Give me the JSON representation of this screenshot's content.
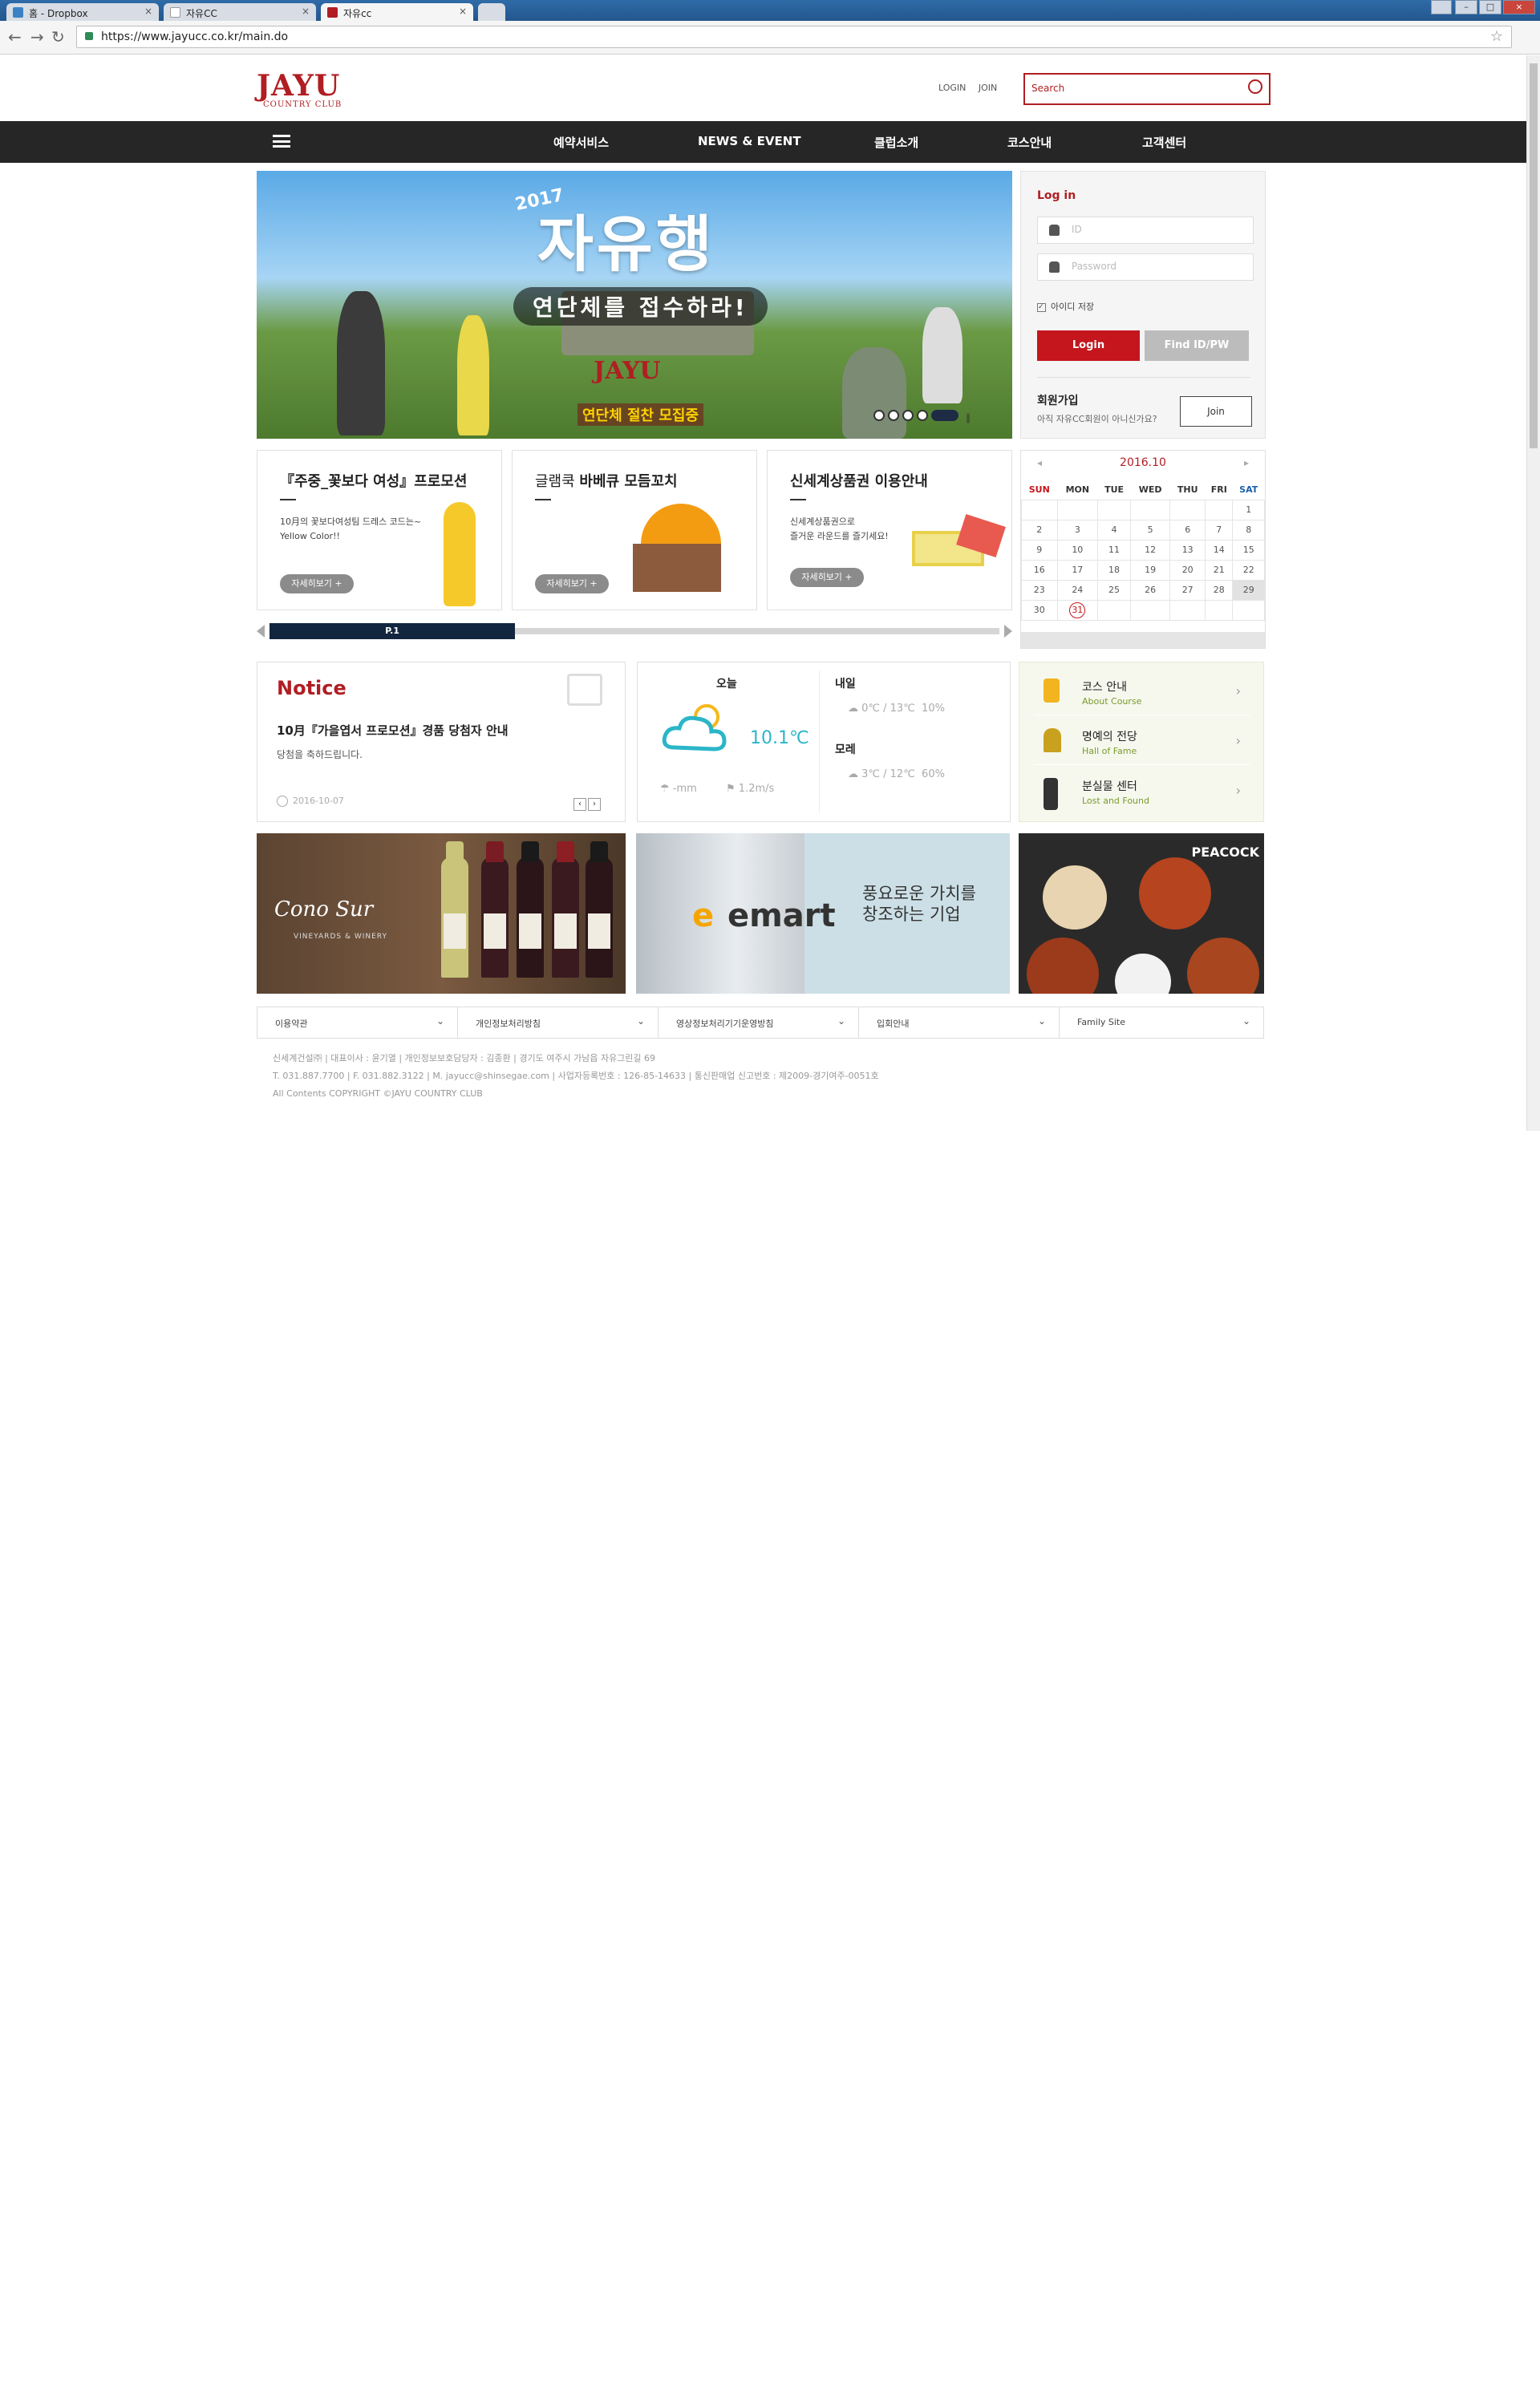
{
  "browser": {
    "tabs": [
      {
        "label": "홈 - Dropbox",
        "icon": "dropbox-icon",
        "color": "#3b82c4"
      },
      {
        "label": "자유CC",
        "icon": "page-icon",
        "color": "#cccccc"
      },
      {
        "label": "자유cc",
        "icon": "jayu-favicon-icon",
        "color": "#b01e23"
      }
    ],
    "url": "https://www.jayucc.co.kr/main.do"
  },
  "site": {
    "logo_main": "JAYU",
    "logo_sub": "COUNTRY CLUB",
    "top_links": {
      "login": "LOGIN",
      "join": "JOIN"
    },
    "search_placeholder": "Search",
    "nav": [
      "예약서비스",
      "NEWS & EVENT",
      "클럽소개",
      "코스안내",
      "고객센터"
    ],
    "accent": "#b01e23"
  },
  "hero": {
    "year": "2017",
    "title": "자유행",
    "subtitle": "연단체를 접수하라!",
    "brand": "JAYU",
    "recruit": "연단체 절찬 모집중",
    "slide_count": 5,
    "active_slide": 5
  },
  "login": {
    "title": "Log in",
    "id_placeholder": "ID",
    "pw_placeholder": "Password",
    "save_label": "아이디 저장",
    "login_button": "Login",
    "find_button": "Find ID/PW",
    "join_title": "회원가입",
    "join_desc": "아직 자유CC회원이 아니신가요?",
    "join_button": "Join"
  },
  "promos": [
    {
      "title_prefix": "『주중_꽃보다 여성』",
      "title_main": "프로모션",
      "desc": "10月의 꽃보다여성팀 드레스 코드는~\nYellow Color!!",
      "more": "자세히보기 +"
    },
    {
      "title_prefix": "글램쿡 ",
      "title_main": "바베큐 모듬꼬치",
      "desc": "",
      "more": "자세히보기 +"
    },
    {
      "title_prefix": "",
      "title_main": "신세계상품권 이용안내",
      "desc": "신세계상품권으로\n즐거운 라운드를 즐기세요!",
      "more": "자세히보기 +"
    }
  ],
  "slider": {
    "page_label": "P.1"
  },
  "calendar": {
    "month": "2016.10",
    "days": [
      "SUN",
      "MON",
      "TUE",
      "WED",
      "THU",
      "FRI",
      "SAT"
    ],
    "weeks": [
      [
        "",
        "",
        "",
        "",
        "",
        "",
        "1"
      ],
      [
        "2",
        "3",
        "4",
        "5",
        "6",
        "7",
        "8"
      ],
      [
        "9",
        "10",
        "11",
        "12",
        "13",
        "14",
        "15"
      ],
      [
        "16",
        "17",
        "18",
        "19",
        "20",
        "21",
        "22"
      ],
      [
        "23",
        "24",
        "25",
        "26",
        "27",
        "28",
        "29"
      ],
      [
        "30",
        "31",
        "",
        "",
        "",
        "",
        ""
      ]
    ],
    "today": "31",
    "highlighted": "29"
  },
  "notice": {
    "title": "Notice",
    "headline": "10月『가을엽서 프로모션』경품 당첨자 안내",
    "desc": "당첨을 축하드립니다.",
    "date": "2016-10-07"
  },
  "weather": {
    "today_label": "오늘",
    "today_temp": "10.1℃",
    "today_rain": "-mm",
    "today_wind": "1.2m/s",
    "tomorrow_label": "내일",
    "tomorrow": "0℃ / 13℃  10%",
    "dayafter_label": "모레",
    "dayafter": "3℃ / 12℃  60%"
  },
  "quick_links": [
    {
      "ko": "코스 안내",
      "en": "About Course",
      "icon": "golf-flag-icon"
    },
    {
      "ko": "명예의 전당",
      "en": "Hall of Fame",
      "icon": "trophy-icon"
    },
    {
      "ko": "분실물 센터",
      "en": "Lost and Found",
      "icon": "golf-bag-icon"
    }
  ],
  "banners": {
    "wine_brand": "Cono Sur",
    "wine_sub": "VINEYARDS & WINERY",
    "emart": "emart",
    "emart_tagline": "풍요로운 가치를\n창조하는 기업",
    "peacock": "PEACOCK"
  },
  "footer": {
    "selects": [
      "이용약관",
      "개인정보처리방침",
      "영상정보처리기기운영방침",
      "입회안내",
      "Family Site"
    ],
    "line1": "신세계건설㈜  |  대표이사 : 윤기열  |  개인정보보호담당자 : 김종환  |  경기도 여주시 가남읍 자유그린길 69",
    "line2": "T. 031.887.7700  |  F. 031.882.3122  |  M. jayucc@shinsegae.com  |  사업자등록번호 : 126-85-14633  |  통신판매업 신고번호 : 제2009-경기여주-0051호",
    "line3": "All Contents COPYRIGHT ©JAYU COUNTRY CLUB"
  }
}
